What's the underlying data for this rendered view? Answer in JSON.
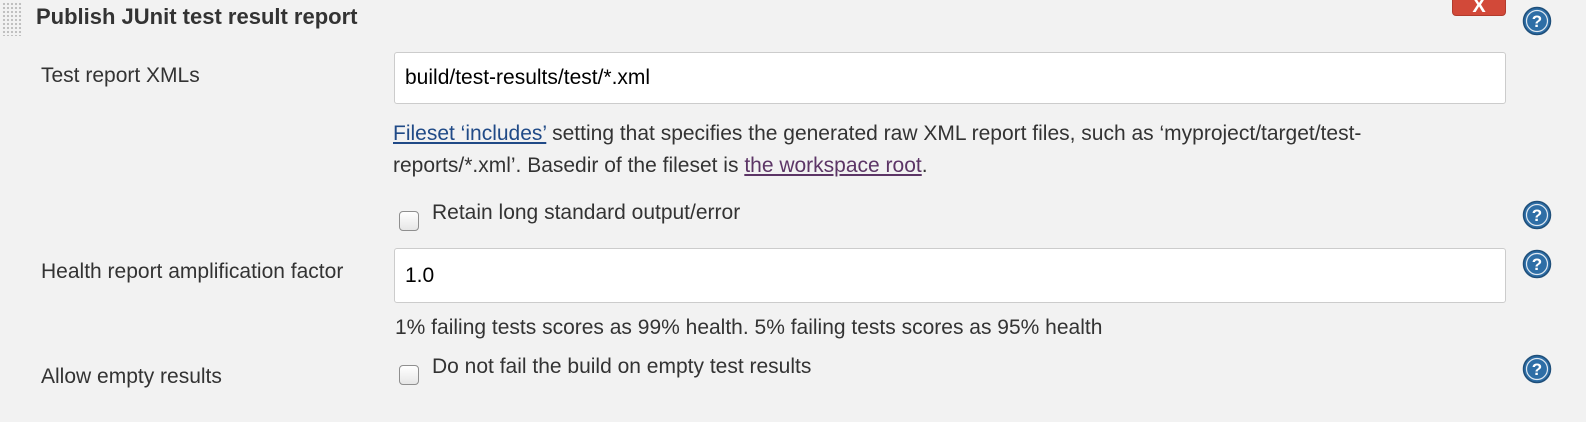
{
  "section": {
    "title": "Publish JUnit test result report",
    "delete_label": "X",
    "help_icon": "question-mark-icon"
  },
  "test_report": {
    "label": "Test report XMLs",
    "value": "build/test-results/test/*.xml",
    "description": {
      "link1": "Fileset ‘includes’",
      "text1": " setting that specifies the generated raw XML report files, such as ‘myproject/target/test-reports/*.xml’. Basedir of the fileset is ",
      "link2": "the workspace root",
      "text2": "."
    }
  },
  "retain_output": {
    "checkbox_label": "Retain long standard output/error",
    "checked": false
  },
  "health_factor": {
    "label": "Health report amplification factor",
    "value": "1.0",
    "hint": "1% failing tests scores as 99% health. 5% failing tests scores as 95% health"
  },
  "allow_empty": {
    "label": "Allow empty results",
    "checkbox_label": "Do not fail the build on empty test results",
    "checked": false
  },
  "colors": {
    "background": "#f2f2f2",
    "delete_button": "#d24939",
    "link": "#204a87",
    "visited_link": "#5c3566",
    "help_icon": "#2e6ea6"
  }
}
